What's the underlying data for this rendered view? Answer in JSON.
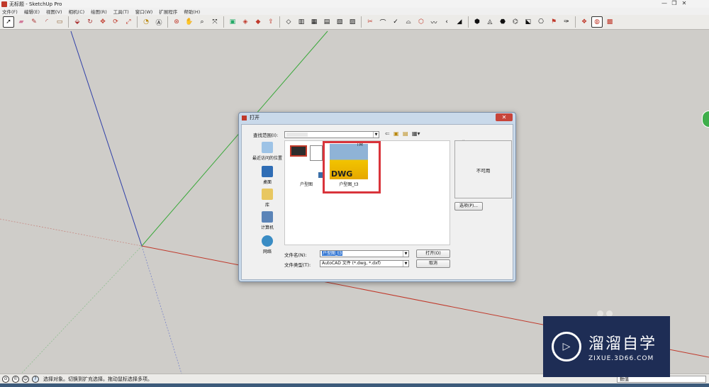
{
  "window": {
    "title": "无标题 - SketchUp Pro",
    "controls": [
      "—",
      "❐",
      "✕"
    ]
  },
  "menu": [
    "文件(F)",
    "编辑(E)",
    "视图(V)",
    "相机(C)",
    "绘图(R)",
    "工具(T)",
    "窗口(W)",
    "扩展程序",
    "帮助(H)"
  ],
  "toolbar_icons": [
    "select-icon",
    "eraser-icon",
    "pencil-icon",
    "arc-icon",
    "rectangle-icon",
    "push-pull-icon",
    "follow-me-icon",
    "move-icon",
    "rotate-icon",
    "scale-icon",
    "tape-measure-icon",
    "text-icon",
    "orbit-icon",
    "pan-icon",
    "zoom-icon",
    "zoom-extents-icon",
    "component-icon",
    "warehouse-icon",
    "extension-icon",
    "share-icon",
    "solid-tools-icon",
    "section-icon",
    "sandbox-icon",
    "styles-icon",
    "layers-icon",
    "scenes-icon",
    "outer-shell-icon",
    "intersect-icon",
    "union-icon",
    "subtract-icon",
    "trim-icon",
    "split-icon",
    "smoove-icon",
    "stamp-icon",
    "drape-icon",
    "add-detail-icon",
    "flip-edge-icon",
    "geo-location-icon",
    "photo-texture-icon",
    "match-photo-icon",
    "model-info-icon",
    "ruby-console-icon",
    "su-logo-icon"
  ],
  "dialog": {
    "title": "打开",
    "close": "✕",
    "lookin_label": "查找范围(I):",
    "lookin_value": "",
    "places": [
      "最近访问的位置",
      "桌面",
      "库",
      "计算机",
      "网络"
    ],
    "files": [
      {
        "name": "户型图",
        "type": "folder-thumbnail"
      },
      {
        "name": "户型图_t3",
        "type": "dwg"
      }
    ],
    "dwg_badge": "DWG",
    "tm": "TM",
    "preview_label": "预览",
    "preview_text": "不可用",
    "options_button": "选项(P)...",
    "filename_label": "文件名(N):",
    "filename_value": "户型图_t3",
    "filetype_label": "文件类型(T):",
    "filetype_value": "AutoCAD 文件 (*.dwg, *.dxf)",
    "open_button": "打开(O)",
    "cancel_button": "取消"
  },
  "status": {
    "text": "选择对象。切换到扩充选择。拖动鼠标选择多项。",
    "measure_label": "数值"
  },
  "watermark": {
    "title": "溜溜自学",
    "url": "ZIXUE.3D66.COM"
  },
  "colors": {
    "axis_red": "#c0392b",
    "axis_green": "#3aa83a",
    "axis_blue": "#2f3fa8",
    "highlight": "#d9343b",
    "watermark_bg": "#1e2d55"
  }
}
